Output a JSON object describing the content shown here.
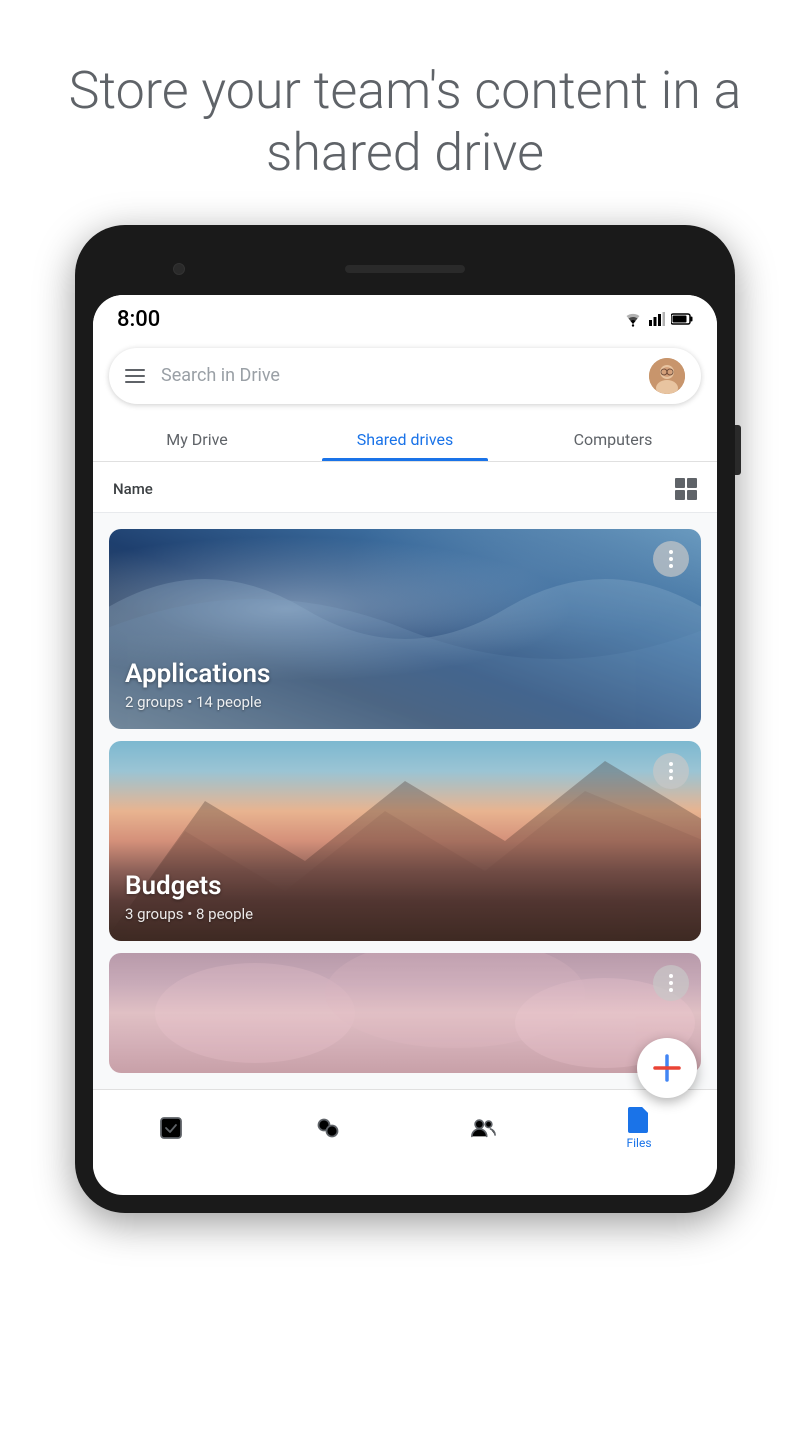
{
  "promo": {
    "title": "Store your team's content in a shared drive"
  },
  "status_bar": {
    "time": "8:00",
    "wifi": "wifi-icon",
    "signal": "signal-icon",
    "battery": "battery-icon"
  },
  "search": {
    "placeholder": "Search in Drive",
    "hamburger_label": "Menu",
    "avatar_label": "User avatar"
  },
  "tabs": [
    {
      "id": "my-drive",
      "label": "My Drive",
      "active": false
    },
    {
      "id": "shared-drives",
      "label": "Shared drives",
      "active": true
    },
    {
      "id": "computers",
      "label": "Computers",
      "active": false
    }
  ],
  "sort": {
    "label": "Name",
    "view_icon": "list-view-icon"
  },
  "drives": [
    {
      "id": "applications",
      "title": "Applications",
      "subtitle": "2 groups • 14 people",
      "theme": "applications"
    },
    {
      "id": "budgets",
      "title": "Budgets",
      "subtitle": "3 groups • 8 people",
      "theme": "budgets"
    },
    {
      "id": "third",
      "title": "",
      "subtitle": "",
      "theme": "third"
    }
  ],
  "fab": {
    "label": "New"
  },
  "bottom_nav": [
    {
      "id": "priority",
      "icon": "check-square-icon",
      "label": "",
      "active": false
    },
    {
      "id": "home",
      "icon": "circles-icon",
      "label": "",
      "active": false
    },
    {
      "id": "shared",
      "icon": "people-icon",
      "label": "",
      "active": false
    },
    {
      "id": "files",
      "icon": "files-icon",
      "label": "Files",
      "active": true
    }
  ]
}
